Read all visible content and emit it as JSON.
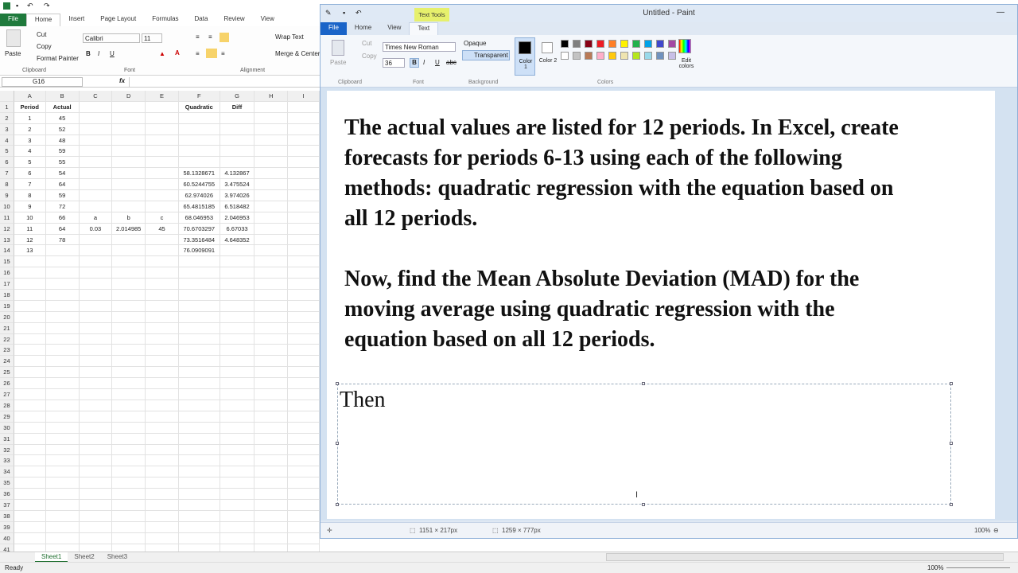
{
  "excel": {
    "tabs": [
      "File",
      "Home",
      "Insert",
      "Page Layout",
      "Formulas",
      "Data",
      "Review",
      "View"
    ],
    "clipboard": {
      "paste": "Paste",
      "cut": "Cut",
      "copy": "Copy",
      "format_painter": "Format Painter",
      "label": "Clipboard"
    },
    "font": {
      "name": "Calibri",
      "size": "11",
      "label": "Font"
    },
    "alignment": {
      "wrap": "Wrap Text",
      "merge": "Merge & Center",
      "label": "Alignment"
    },
    "name_box": "G16",
    "fx": "fx",
    "columns": [
      "A",
      "B",
      "C",
      "D",
      "E",
      "F",
      "G",
      "H",
      "I"
    ],
    "rows": [
      [
        "Period",
        "Actual",
        "",
        "",
        "",
        "Quadratic",
        "Diff",
        "",
        ""
      ],
      [
        "1",
        "45",
        "",
        "",
        "",
        "",
        "",
        "",
        ""
      ],
      [
        "2",
        "52",
        "",
        "",
        "",
        "",
        "",
        "",
        ""
      ],
      [
        "3",
        "48",
        "",
        "",
        "",
        "",
        "",
        "",
        ""
      ],
      [
        "4",
        "59",
        "",
        "",
        "",
        "",
        "",
        "",
        ""
      ],
      [
        "5",
        "55",
        "",
        "",
        "",
        "",
        "",
        "",
        ""
      ],
      [
        "6",
        "54",
        "",
        "",
        "",
        "58.1328671",
        "4.132867",
        "",
        ""
      ],
      [
        "7",
        "64",
        "",
        "",
        "",
        "60.5244755",
        "3.475524",
        "",
        ""
      ],
      [
        "8",
        "59",
        "",
        "",
        "",
        "62.974026",
        "3.974026",
        "",
        ""
      ],
      [
        "9",
        "72",
        "",
        "",
        "",
        "65.4815185",
        "6.518482",
        "",
        ""
      ],
      [
        "10",
        "66",
        "a",
        "b",
        "c",
        "68.046953",
        "2.046953",
        "",
        ""
      ],
      [
        "11",
        "64",
        "0.03",
        "2.014985",
        "45",
        "70.6703297",
        "6.67033",
        "",
        ""
      ],
      [
        "12",
        "78",
        "",
        "",
        "",
        "73.3516484",
        "4.648352",
        "",
        ""
      ],
      [
        "13",
        "",
        "",
        "",
        "",
        "76.0909091",
        "",
        "",
        ""
      ],
      [
        "",
        "",
        "",
        "",
        "",
        "",
        "",
        "",
        ""
      ],
      [
        "",
        "",
        "",
        "",
        "",
        "",
        "",
        "",
        ""
      ],
      [
        "",
        "",
        "",
        "",
        "",
        "",
        "",
        "",
        ""
      ],
      [
        "",
        "",
        "",
        "",
        "",
        "",
        "",
        "",
        ""
      ],
      [
        "",
        "",
        "",
        "",
        "",
        "",
        "",
        "",
        ""
      ],
      [
        "",
        "",
        "",
        "",
        "",
        "",
        "",
        "",
        ""
      ],
      [
        "",
        "",
        "",
        "",
        "",
        "",
        "",
        "",
        ""
      ],
      [
        "",
        "",
        "",
        "",
        "",
        "",
        "",
        "",
        ""
      ],
      [
        "",
        "",
        "",
        "",
        "",
        "",
        "",
        "",
        ""
      ],
      [
        "",
        "",
        "",
        "",
        "",
        "",
        "",
        "",
        ""
      ],
      [
        "",
        "",
        "",
        "",
        "",
        "",
        "",
        "",
        ""
      ],
      [
        "",
        "",
        "",
        "",
        "",
        "",
        "",
        "",
        ""
      ],
      [
        "",
        "",
        "",
        "",
        "",
        "",
        "",
        "",
        ""
      ],
      [
        "",
        "",
        "",
        "",
        "",
        "",
        "",
        "",
        ""
      ],
      [
        "",
        "",
        "",
        "",
        "",
        "",
        "",
        "",
        ""
      ],
      [
        "",
        "",
        "",
        "",
        "",
        "",
        "",
        "",
        ""
      ],
      [
        "",
        "",
        "",
        "",
        "",
        "",
        "",
        "",
        ""
      ],
      [
        "",
        "",
        "",
        "",
        "",
        "",
        "",
        "",
        ""
      ],
      [
        "",
        "",
        "",
        "",
        "",
        "",
        "",
        "",
        ""
      ],
      [
        "",
        "",
        "",
        "",
        "",
        "",
        "",
        "",
        ""
      ],
      [
        "",
        "",
        "",
        "",
        "",
        "",
        "",
        "",
        ""
      ],
      [
        "",
        "",
        "",
        "",
        "",
        "",
        "",
        "",
        ""
      ],
      [
        "",
        "",
        "",
        "",
        "",
        "",
        "",
        "",
        ""
      ],
      [
        "",
        "",
        "",
        "",
        "",
        "",
        "",
        "",
        ""
      ],
      [
        "",
        "",
        "",
        "",
        "",
        "",
        "",
        "",
        ""
      ],
      [
        "",
        "",
        "",
        "",
        "",
        "",
        "",
        "",
        ""
      ],
      [
        "",
        "",
        "",
        "",
        "",
        "",
        "",
        "",
        ""
      ]
    ],
    "sheets": [
      "Sheet1",
      "Sheet2",
      "Sheet3"
    ],
    "status": "Ready",
    "zoom": "100%"
  },
  "paint": {
    "title": "Untitled - Paint",
    "context_tab": "Text Tools",
    "tabs": [
      "File",
      "Home",
      "View",
      "Text"
    ],
    "clipboard": {
      "paste": "Paste",
      "cut": "Cut",
      "copy": "Copy",
      "label": "Clipboard"
    },
    "font": {
      "name": "Times New Roman",
      "size": "36",
      "label": "Font"
    },
    "background": {
      "opaque": "Opaque",
      "transparent": "Transparent",
      "label": "Background"
    },
    "colors": {
      "color1": "Color 1",
      "color2": "Color 2",
      "edit": "Edit colors",
      "label": "Colors"
    },
    "palette": [
      "#000000",
      "#7f7f7f",
      "#880015",
      "#ed1c24",
      "#ff7f27",
      "#fff200",
      "#22b14c",
      "#00a2e8",
      "#3f48cc",
      "#a349a4",
      "#ffffff",
      "#c3c3c3",
      "#b97a57",
      "#ffaec9",
      "#ffc90e",
      "#efe4b0",
      "#b5e61d",
      "#99d9ea",
      "#7092be",
      "#c8bfe7"
    ],
    "prompt_p1": "The actual values are listed for 12 periods.  In Excel, create forecasts for periods 6-13 using each of the following methods: quadratic regression with the equation based on all 12 periods.",
    "prompt_p2": "Now, find the Mean Absolute Deviation (MAD) for the moving average using quadratic regression with the equation based on all 12 periods.",
    "typed": "Then",
    "status_selection": "1151 × 217px",
    "status_size": "1259 × 777px",
    "zoom": "100%"
  }
}
